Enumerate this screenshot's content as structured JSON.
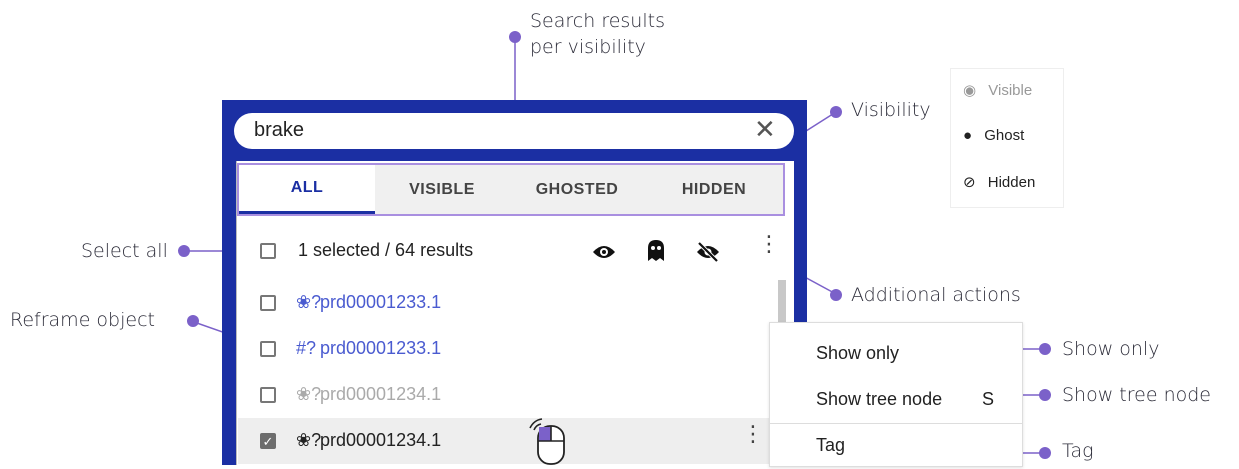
{
  "search": {
    "value": "brake",
    "clear_icon": "close-icon"
  },
  "tabs": [
    "ALL",
    "VISIBLE",
    "GHOSTED",
    "HIDDEN"
  ],
  "toolbar": {
    "summary": "1 selected / 64 results"
  },
  "rows": [
    {
      "name": "prd00001233.1",
      "checked": false,
      "style": "link"
    },
    {
      "name": "prd00001233.1",
      "checked": false,
      "style": "link"
    },
    {
      "name": "prd00001234.1",
      "checked": false,
      "style": "hidden"
    },
    {
      "name": "prd00001234.1",
      "checked": true,
      "style": "normal"
    }
  ],
  "menu": {
    "items": [
      "Show only",
      "Show tree node",
      "Tag"
    ],
    "shortcut": "S"
  },
  "legend": {
    "items": [
      "Visible",
      "Ghost",
      "Hidden"
    ]
  },
  "callouts": {
    "search_results": [
      "Search results",
      "per visibility"
    ],
    "visibility": "Visibility",
    "select_all": "Select all",
    "additional_actions": "Additional actions",
    "reframe_object": "Reframe object",
    "show_only": "Show only",
    "show_tree_node": "Show tree node",
    "tag": "Tag"
  },
  "colors": {
    "header_blue": "#1b2fa3",
    "accent_purple": "#7b61c9",
    "link": "#4a5bd0"
  }
}
